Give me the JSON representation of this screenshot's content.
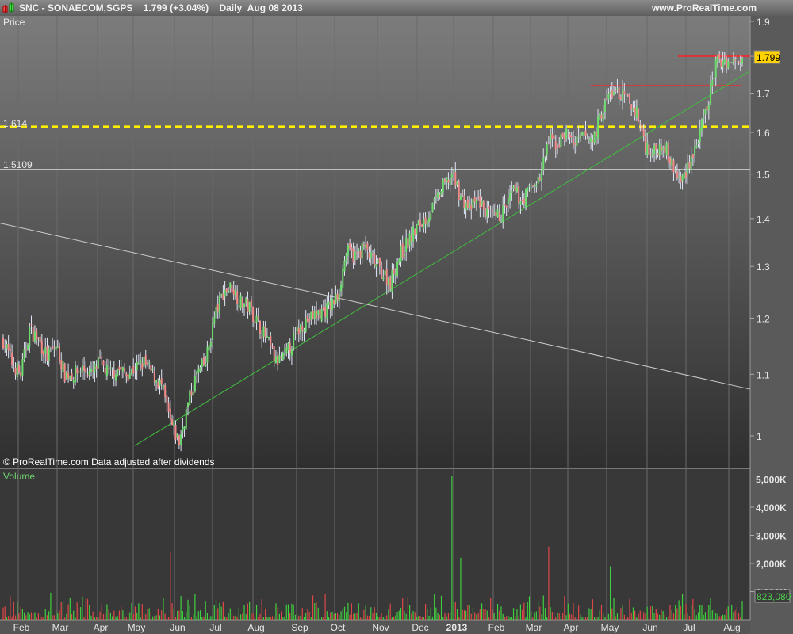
{
  "header": {
    "symbol": "SNC - SONAECOM,SGPS",
    "price": "1.799 (+3.04%)",
    "period": "Daily",
    "date": "Aug 08 2013",
    "site": "www.ProRealTime.com"
  },
  "panels": {
    "price_label": "Price",
    "volume_label": "Volume",
    "copyright": "© ProRealTime.com  Data adjusted after dividends"
  },
  "chart_data": [
    {
      "type": "candlestick",
      "title": "SNC - SONAECOM,SGPS Daily",
      "ylabel": "Price",
      "scale": "log",
      "ylim": [
        0.95,
        1.92
      ],
      "yticks": [
        "1",
        "1.1",
        "1.2",
        "1.3",
        "1.4",
        "1.5",
        "1.6",
        "1.7",
        "1.8",
        "1.9"
      ],
      "xticks": [
        "Feb",
        "Mar",
        "Apr",
        "May",
        "Jun",
        "Jul",
        "Aug",
        "Sep",
        "Oct",
        "Nov",
        "Dec",
        "2013",
        "Feb",
        "Mar",
        "Apr",
        "May",
        "Jun",
        "Jul",
        "Aug"
      ],
      "weekly_close_approx": [
        1.16,
        1.12,
        1.1,
        1.18,
        1.16,
        1.13,
        1.15,
        1.1,
        1.1,
        1.11,
        1.1,
        1.12,
        1.1,
        1.11,
        1.1,
        1.11,
        1.12,
        1.1,
        1.08,
        1.02,
        0.99,
        1.05,
        1.1,
        1.12,
        1.2,
        1.25,
        1.26,
        1.23,
        1.22,
        1.19,
        1.16,
        1.12,
        1.13,
        1.16,
        1.19,
        1.2,
        1.21,
        1.22,
        1.24,
        1.33,
        1.32,
        1.34,
        1.31,
        1.29,
        1.27,
        1.32,
        1.35,
        1.38,
        1.4,
        1.43,
        1.47,
        1.5,
        1.45,
        1.42,
        1.44,
        1.41,
        1.4,
        1.42,
        1.46,
        1.44,
        1.47,
        1.49,
        1.58,
        1.57,
        1.6,
        1.57,
        1.59,
        1.58,
        1.65,
        1.7,
        1.7,
        1.68,
        1.65,
        1.57,
        1.55,
        1.58,
        1.52,
        1.48,
        1.53,
        1.58,
        1.66,
        1.78,
        1.79,
        1.78,
        1.799
      ],
      "last_price": "1.799",
      "levels": [
        {
          "label": "1.614",
          "value": 1.614,
          "color": "#ffee00",
          "style": "dashed"
        },
        {
          "label": "1.5109",
          "value": 1.5109,
          "color": "#dddddd",
          "style": "solid"
        },
        {
          "value": 1.72,
          "color": "#ff2020"
        },
        {
          "value": 1.8,
          "color": "#ff2020"
        }
      ],
      "trendlines": [
        {
          "name": "support",
          "color": "#3fbf3f",
          "from": 0.985,
          "to": 1.76
        },
        {
          "name": "resistance",
          "color": "#cccccc",
          "from": 1.39,
          "to": 1.075
        }
      ]
    },
    {
      "type": "bar",
      "title": "Volume",
      "yticks": [
        "1,000K",
        "2,000K",
        "3,000K",
        "4,000K",
        "5,000K"
      ],
      "ylim": [
        0,
        5200
      ],
      "last_volume": "823,080",
      "spikes_k": [
        {
          "week": 19,
          "value": 2400
        },
        {
          "week": 51,
          "value": 5100
        },
        {
          "week": 52,
          "value": 2200
        },
        {
          "week": 62,
          "value": 2600
        },
        {
          "week": 69,
          "value": 1900
        }
      ]
    }
  ]
}
